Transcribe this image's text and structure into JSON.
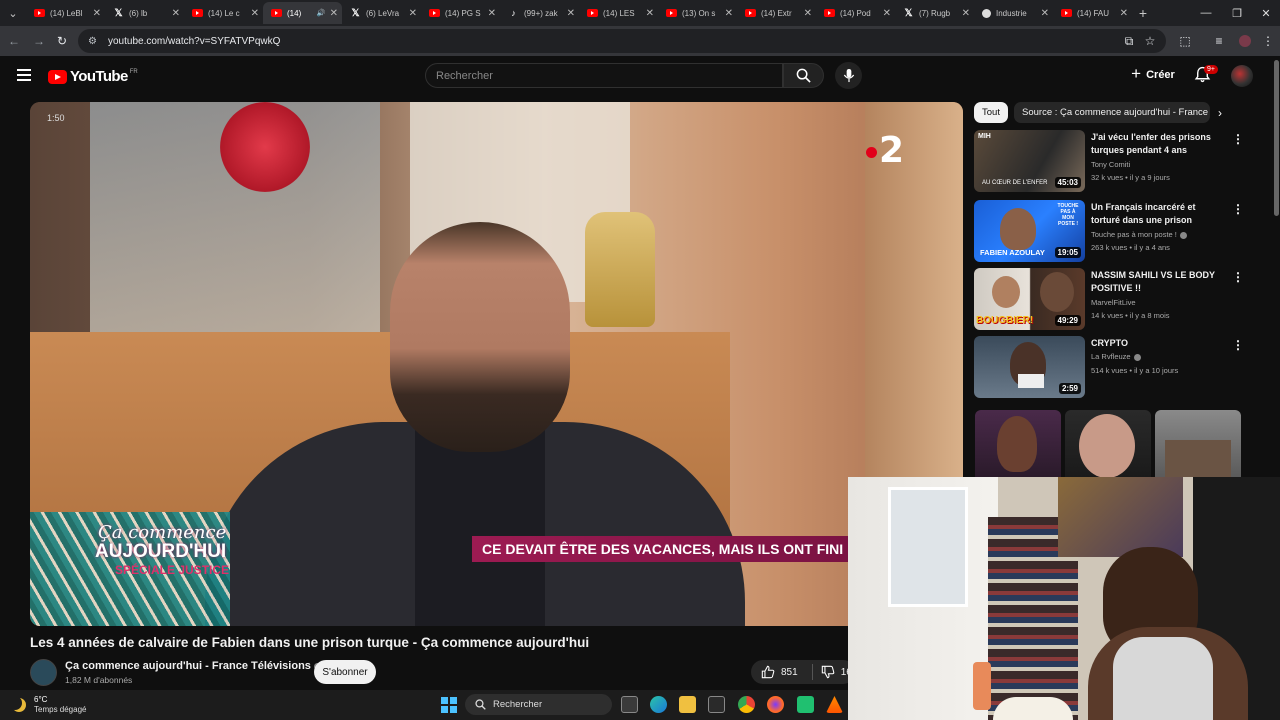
{
  "browser": {
    "tabs": [
      {
        "icon": "youtube-icon",
        "label": "(14) LeBl"
      },
      {
        "icon": "x-icon",
        "label": "(6) lb"
      },
      {
        "icon": "youtube-icon",
        "label": "(14) Le c"
      },
      {
        "icon": "youtube-icon",
        "label": "(14)",
        "active": true
      },
      {
        "icon": "x-icon",
        "label": "(6) LeVra"
      },
      {
        "icon": "youtube-icon",
        "label": "(14) PG S"
      },
      {
        "icon": "tiktok-icon",
        "label": "(99+) zak"
      },
      {
        "icon": "youtube-icon",
        "label": "(14) LES"
      },
      {
        "icon": "youtube-icon",
        "label": "(13) On s"
      },
      {
        "icon": "youtube-icon",
        "label": "(14) Extr"
      },
      {
        "icon": "youtube-icon",
        "label": "(14) Pod"
      },
      {
        "icon": "x-icon",
        "label": "(7) Rugb"
      },
      {
        "icon": "globe-icon",
        "label": "Industrie"
      },
      {
        "icon": "youtube-icon",
        "label": "(14) FAU"
      }
    ],
    "url": "youtube.com/watch?v=SYFATVPqwkQ"
  },
  "header": {
    "logo_text": "YouTube",
    "country_code": "FR",
    "search_placeholder": "Rechercher",
    "create_label": "Créer",
    "notification_count": "9+"
  },
  "player": {
    "time_overlay": "1:50",
    "channel_number": "2",
    "show_logo_line1": "Ça commence",
    "show_logo_line2": "AUJOURD'HUI",
    "show_logo_line3": "SPÉCIALE JUSTICE",
    "lower_third": "CE DEVAIT ÊTRE DES VACANCES, MAIS ILS ONT FINI EN PRIS"
  },
  "video": {
    "title": "Les 4 années de calvaire de Fabien dans une prison turque - Ça commence aujourd'hui",
    "channel_name": "Ça commence aujourd'hui - France Télévisions",
    "subscribers": "1,82 M d'abonnés",
    "subscribe_label": "S'abonner",
    "likes": "851",
    "dislikes": "16"
  },
  "sidebar": {
    "chips": [
      "Tout",
      "Source : Ça commence aujourd'hui - France"
    ],
    "recommendations": [
      {
        "title": "J'ai vécu l'enfer des prisons turques pendant 4 ans",
        "channel": "Tony Comiti",
        "verified": false,
        "meta": "32 k vues • il y a 9 jours",
        "duration": "45:03",
        "thumb_text": "AU CŒUR DE L'ENFER",
        "thumb_badge": "MIH"
      },
      {
        "title": "Un Français incarcéré et torturé dans une prison turque : que ...",
        "channel": "Touche pas à mon poste !",
        "verified": true,
        "meta": "263 k vues • il y a 4 ans",
        "duration": "19:05",
        "thumb_text": "FABIEN AZOULAY",
        "thumb_badge": "TOUCHE PAS À MON POSTE !"
      },
      {
        "title": "NASSIM SAHILI VS LE BODY POSITIVE !!",
        "channel": "MarvelFitLive",
        "verified": false,
        "meta": "14 k vues • il y a 8 mois",
        "duration": "49:29",
        "thumb_text": "BOUGBIER!"
      },
      {
        "title": "CRYPTO",
        "channel": "La Rvfleuze",
        "verified": true,
        "meta": "514 k vues • il y a 10 jours",
        "duration": "2:59",
        "thumb_text": ""
      }
    ]
  },
  "taskbar": {
    "weather_temp": "6°C",
    "weather_desc": "Temps dégagé",
    "search_label": "Rechercher"
  }
}
